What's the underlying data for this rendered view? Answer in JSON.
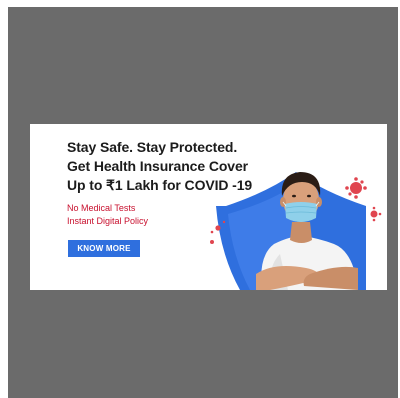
{
  "banner": {
    "headline_line1": "Stay Safe. Stay Protected.",
    "headline_line2": "Get Health Insurance Cover",
    "headline_line3": "Up to ₹1 Lakh for COVID -19",
    "feature1": "No Medical Tests",
    "feature2": "Instant Digital Policy",
    "cta_label": "KNOW MORE"
  },
  "colors": {
    "frame_bg": "#6b6b6b",
    "banner_bg": "#ffffff",
    "headline": "#1c1c1c",
    "feature_text": "#c8102e",
    "cta_bg": "#2f6fde",
    "shield": "#2f6fde",
    "virus": "#e0454f"
  },
  "icons": {
    "hero": "masked-man-with-shield-illustration"
  }
}
